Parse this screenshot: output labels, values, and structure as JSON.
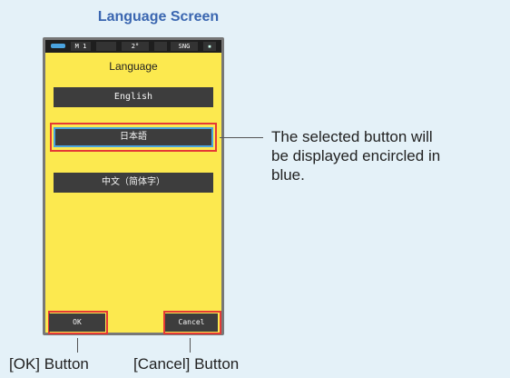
{
  "heading": "Language Screen",
  "statusbar": {
    "mode": "M 1",
    "angle": "2°",
    "sng": "SNG"
  },
  "screen": {
    "title": "Language",
    "languages": [
      {
        "label": "English",
        "selected": false
      },
      {
        "label": "日本語",
        "selected": true
      },
      {
        "label": "中文（简体字）",
        "selected": false
      }
    ],
    "ok_label": "OK",
    "cancel_label": "Cancel"
  },
  "annotations": {
    "selected_note_line1": "The selected button will",
    "selected_note_line2": "be displayed encircled in",
    "selected_note_line3": "blue.",
    "ok_caption": "[OK] Button",
    "cancel_caption": "[Cancel] Button"
  },
  "colors": {
    "background": "#e4f1f8",
    "screen": "#fce94f",
    "heading": "#3a66b0",
    "highlight": "#e53935",
    "selected_ring": "#4aa3df"
  }
}
